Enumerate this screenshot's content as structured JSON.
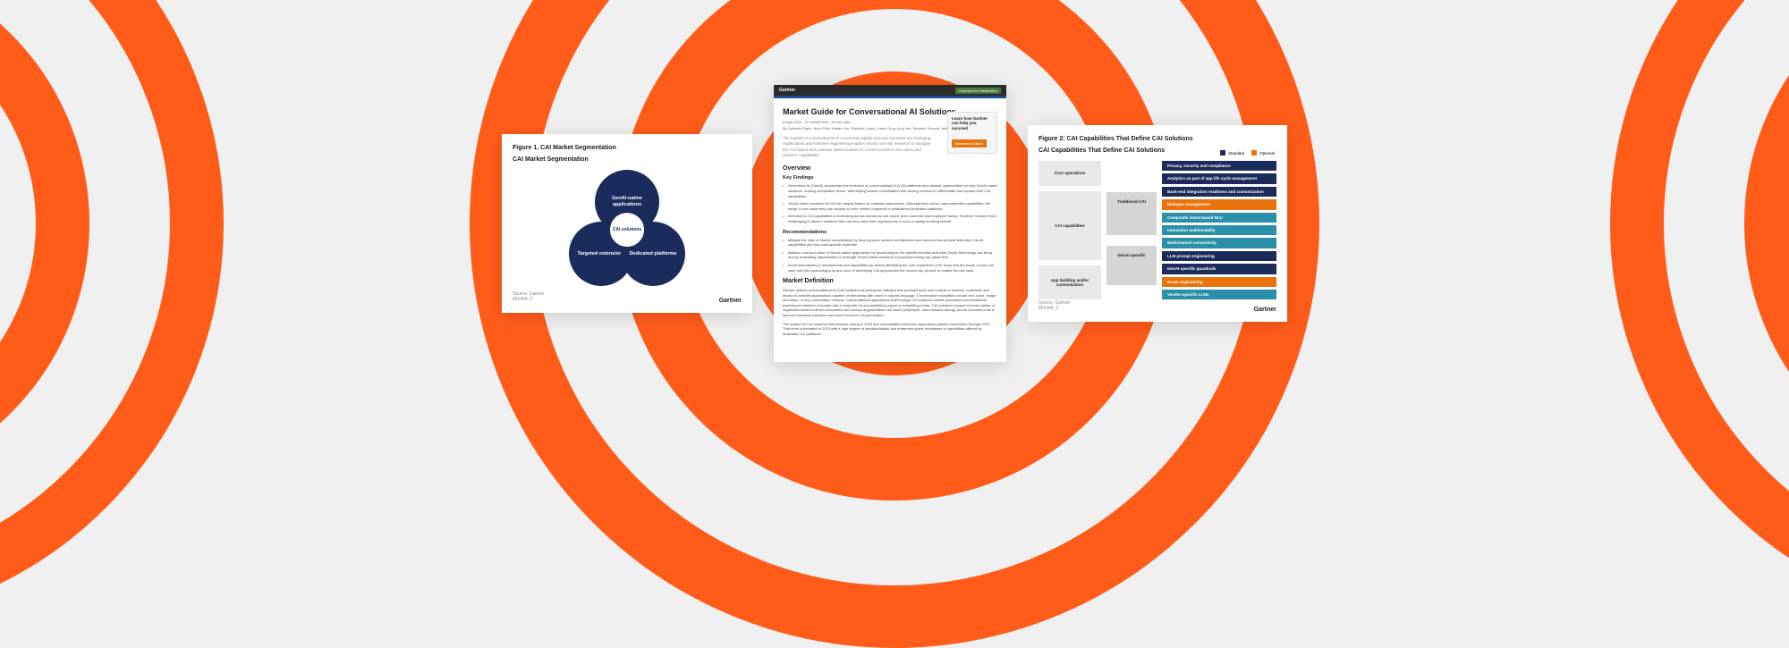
{
  "figure1": {
    "title": "Figure 1. CAI Market Segmentation",
    "subtitle": "CAI Market Segmentation",
    "venn": {
      "top": "GenAI-native applications",
      "bottom_left": "Targeted extensions",
      "bottom_right": "Dedicated platforms",
      "center": "CAI solutions"
    },
    "source": "Source: Gartner",
    "source_id": "801444_C",
    "brand": "Gartner"
  },
  "center_doc": {
    "header_brand": "Gartner",
    "header_badge": "Licensed for Distribution",
    "title": "Market Guide for Conversational AI Solutions",
    "meta": "8 April 2024 - ID G00807963 - 29 min read",
    "byline": "By Gabriele Rigon, Bern Elliot, Adrian Lee, Danielle Casey, Justin Tung, Anuj Jha, Stephen Emmott, Anthony Mullen, Uma Challa",
    "cta": {
      "text": "Learn how Gartner can help you succeed",
      "button": "Become a Client"
    },
    "intro": "The market of conversational AI is evolving rapidly and new solutions are emerging. Applications and software engineering leaders should use this research to navigate the CAI space and evaluate options based on current trends in use cases and vendors' capabilities.",
    "overview_heading": "Overview",
    "key_findings_heading": "Key Findings",
    "key_findings": [
      "Generative AI (GenAI) accelerated the evolution of conversational AI (CAI) platforms and created opportunities for new GenAI-native solutions, making competition fiercer. Intensifying market consolidation and forcing vendors to differentiate and expand their CAI capabilities.",
      "GenAI-native solutions for CAI are largely based on multistep approaches. Although they unlock unprecedented capabilities, the range of use cases they can support is more limited compared to established dedicated platforms.",
      "Demand for CAI capabilities is increasing across numerous use cases, both customer and employee facing. However, leaders find it challenging to discern solutions that can best meet their requirements in such a rapidly-evolving market."
    ],
    "recommendations_heading": "Recommendations",
    "recommendations": [
      "Mitigate the risks of market consolidation by favoring open solution architectures and vendors that provide distinctive GenAI capabilities and use-case-specific expertise.",
      "Balance cost and value of GenAI-native approaches by accounting for the specific benefits and risks GenAI technology can bring and by evaluating opportunities to leverage GenAI-native solutions in employee facing use cases first.",
      "Avoid mismatches in requirements and capabilities by clearly identifying the user experience (UX) focus and the scope of your use case and then assessing pros and cons of underlying CAI approaches the vendor can provide to enable the use case."
    ],
    "market_def_heading": "Market Definition",
    "market_def_body1": "Gartner defines conversational AI (CAI) solutions as enterprise software that provides tools and controls to develop, customize and deploy AI-enabled applications capable of interacting with users in natural language. Conversation modalities include text, voice, image and video, or any combination of these. Conversational applications built through CAI solutions enable automated conversational experiences between a human and a computer for accomplishing a goal or completing a task. CAI solutions support a broad variety of organizationwide AI-driven automation and human augmentation use cases (employee- and customer-facing) across business units to improve business outcomes and save resources via automation.",
    "market_def_body2": "The market for CAI solutions first became strong in 2018 and consolidated enterprise approaches gained momentum through 2022. That trend culminated in 2023 with a high degree of standardization and enterprise-grade robustness of capabilities offered by dedicated CAI platforms."
  },
  "figure2": {
    "title": "Figure 2: CAI Capabilities That Define CAI Solutions",
    "subtitle": "CAI Capabilities That Define CAI Solutions",
    "legend": {
      "standard": "Standard",
      "optional": "Optional"
    },
    "side_main": "CAI capabilities",
    "mid_labels": {
      "core": "Core operations",
      "trad": "Traditional CAI",
      "appbuild": "App building and/or customization",
      "genai": "GenAI specific"
    },
    "caps": {
      "privacy": "Privacy, security and compliance",
      "analytics": "Analytics as part of app life cycle management",
      "backend": "Back-end integration readiness and customization",
      "dialogue": "Dialogue management",
      "nlu": "Composite intent-based NLU",
      "multimodal": "Interaction multimodality",
      "multichannel": "Multichannel connectivity",
      "llm_prompt": "LLM prompt engineering",
      "guardrails": "GenAI-specific guardrails",
      "routing": "Route engineering",
      "vendor_llm": "Vendor-specific LLMs"
    },
    "source": "Source: Gartner",
    "source_id": "801444_C",
    "brand": "Gartner"
  }
}
